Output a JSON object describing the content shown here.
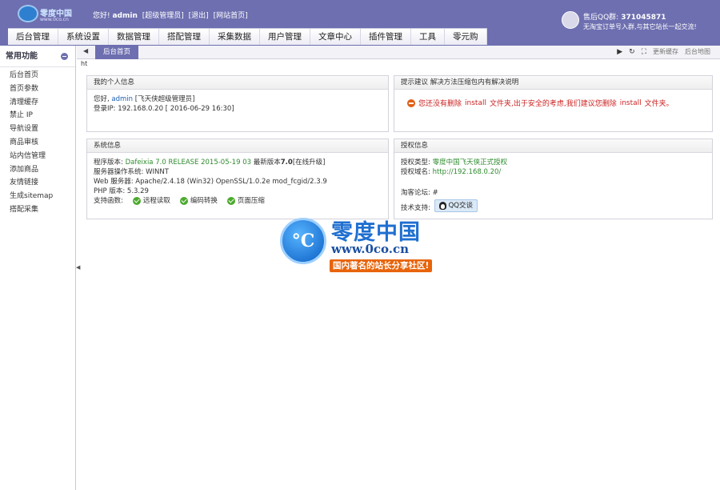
{
  "header": {
    "logo_text": "零度中国",
    "logo_url": "www.0co.cn",
    "greeting_prefix": "您好!",
    "username": "admin",
    "role": "[超级管理员]",
    "logout": "[退出]",
    "site_home": "[网站首页]",
    "qq_label": "售后QQ群:",
    "qq_number": "371045871",
    "qq_message": "无淘宝订单号入群,与其它站长一起交流!"
  },
  "nav": [
    "后台管理",
    "系统设置",
    "数据管理",
    "搭配管理",
    "采集数据",
    "用户管理",
    "文章中心",
    "插件管理",
    "工具",
    "零元购"
  ],
  "sidebar": {
    "title": "常用功能",
    "items": [
      "后台首页",
      "首页参数",
      "清理缓存",
      "禁止 IP",
      "导航设置",
      "商品审核",
      "站内信管理",
      "添加商品",
      "友情链接",
      "生成sitemap",
      "搭配采集"
    ]
  },
  "tabs": {
    "active": "后台首页",
    "clear_cache": "更新缓存",
    "admin_map": "后台地图"
  },
  "ht_text": "ht",
  "panels": {
    "personal": {
      "title": "我的个人信息",
      "hello_prefix": "您好,",
      "username": "admin",
      "role": "[飞天侠超级管理员]",
      "login_ip": "登录IP:  192.168.0.20 [ 2016-06-29 16:30]"
    },
    "tips": {
      "title": "提示建议 解决方法压缩包内有解决说明",
      "w1": "您还没有删除",
      "w2": "install",
      "w3": "文件夹,出于安全的考虑,我们建议您删除",
      "w4": "install",
      "w5": "文件夹。"
    },
    "system": {
      "title": "系统信息",
      "version_label": "程序版本:",
      "version_value": "Dafeixia 7.0 RELEASE 2015-05-19 03",
      "latest_label": "最新版本",
      "latest_value": "7.0",
      "upgrade": "[在线升级]",
      "os": "服务器操作系统:  WINNT",
      "web_server": "Web 服务器:  Apache/2.4.18 (Win32) OpenSSL/1.0.2e mod_fcgid/2.3.9",
      "php": "PHP 版本:  5.3.29",
      "functions_label": "支持函数:",
      "functions": [
        "远程读取",
        "编码转换",
        "页面压缩"
      ]
    },
    "license": {
      "title": "授权信息",
      "type_label": "授权类型:",
      "type_value": "零度中国飞天侠正式授权",
      "domain_label": "授权域名:",
      "domain_value": "http://192.168.0.20/",
      "forum_label": "淘客论坛:",
      "forum_value": "#",
      "support_label": "技术支持:",
      "support_button": "QQ交谈"
    }
  },
  "watermark": {
    "title": "零度中国",
    "url": "www.0co.cn",
    "slogan": "国内著名的站长分享社区!",
    "symbol": "°C"
  }
}
